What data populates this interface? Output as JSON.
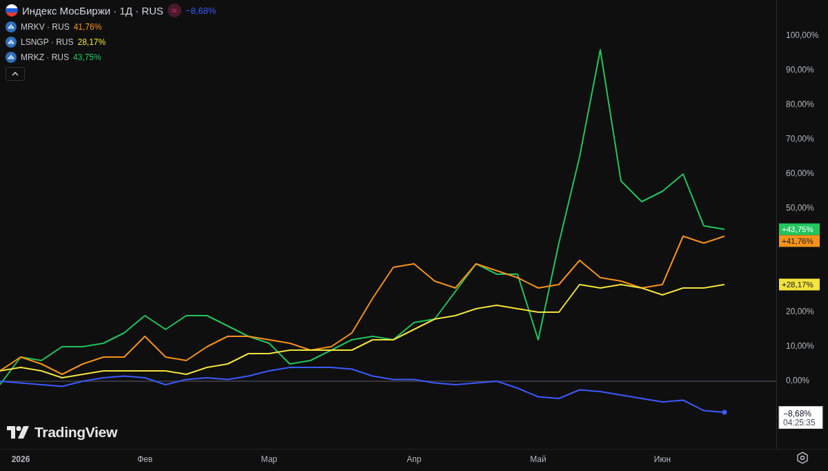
{
  "legend": {
    "main": {
      "title": "Индекс МосБиржи · 1Д · RUS",
      "badge": "≈",
      "change": "−8,68%",
      "color": "#3d5afe"
    },
    "symbols": [
      {
        "name": "MRKV · RUS",
        "change": "41,76%",
        "color": "#f7931a"
      },
      {
        "name": "LSNGP · RUS",
        "change": "28,17%",
        "color": "#f2e33d"
      },
      {
        "name": "MRKZ · RUS",
        "change": "43,75%",
        "color": "#22c55e"
      }
    ]
  },
  "logo": {
    "text": "TradingView"
  },
  "chart": {
    "chart_data": {
      "type": "line",
      "categories": [
        null,
        "2026",
        null,
        null,
        null,
        null,
        null,
        "Фев",
        null,
        null,
        null,
        null,
        null,
        "Мар",
        null,
        null,
        null,
        null,
        null,
        null,
        "Апр",
        null,
        null,
        null,
        null,
        null,
        "Май",
        null,
        null,
        null,
        null,
        null,
        "Июн",
        null,
        null,
        null
      ],
      "ylim": [
        -19.6,
        110.4
      ],
      "yticks": [
        {
          "value": 0,
          "label": "0,00%"
        },
        {
          "value": 10,
          "label": "10,00%"
        },
        {
          "value": 20,
          "label": "20,00%"
        },
        {
          "value": 50,
          "label": "50,00%"
        },
        {
          "value": 60,
          "label": "60,00%"
        },
        {
          "value": 70,
          "label": "70,00%"
        },
        {
          "value": 80,
          "label": "80,00%"
        },
        {
          "value": 90,
          "label": "90,00%"
        },
        {
          "value": 100,
          "label": "100,00%"
        }
      ],
      "series": [
        {
          "color": "#22c55e",
          "values": [
            -1,
            7,
            6,
            10,
            10,
            11,
            14,
            19,
            15,
            19,
            19,
            16,
            13,
            11,
            5,
            6,
            9,
            12,
            13,
            12,
            17,
            18,
            26,
            34,
            31,
            31,
            12,
            40,
            65,
            96,
            58,
            52,
            55,
            60,
            45,
            44
          ]
        },
        {
          "color": "#f7931a",
          "values": [
            3,
            7,
            5,
            2,
            5,
            7,
            7,
            13,
            7,
            6,
            10,
            13,
            13,
            12,
            11,
            9,
            10,
            14,
            24,
            33,
            34,
            29,
            27,
            34,
            32,
            30,
            27,
            28,
            35,
            30,
            29,
            27,
            28,
            42,
            40,
            42
          ]
        },
        {
          "color": "#f2e33d",
          "values": [
            3,
            4,
            3,
            1,
            2,
            3,
            3,
            3,
            3,
            2,
            4,
            5,
            8,
            8,
            9,
            9,
            9,
            9,
            12,
            12,
            15,
            18,
            19,
            21,
            22,
            21,
            20,
            20,
            28,
            27,
            28,
            27,
            25,
            27,
            27,
            28
          ]
        },
        {
          "color": "#3d5afe",
          "values": [
            0,
            -0.5,
            -1,
            -1.5,
            0,
            1,
            1.5,
            1,
            -1,
            0.5,
            1,
            0.5,
            1.5,
            3,
            4,
            4,
            4,
            3.5,
            1.5,
            0.5,
            0.5,
            -0.5,
            -1,
            -0.5,
            0,
            -2,
            -4.5,
            -5,
            -2.5,
            -3,
            -4,
            -5,
            -6,
            -5.5,
            -8.5,
            -9
          ]
        }
      ]
    },
    "price_badges": [
      {
        "text": "+43,75%"
      },
      {
        "text": "+41,76%"
      },
      {
        "text": "+28,17%"
      },
      {
        "text": "−8,68%",
        "time": "04:25:35"
      }
    ]
  }
}
